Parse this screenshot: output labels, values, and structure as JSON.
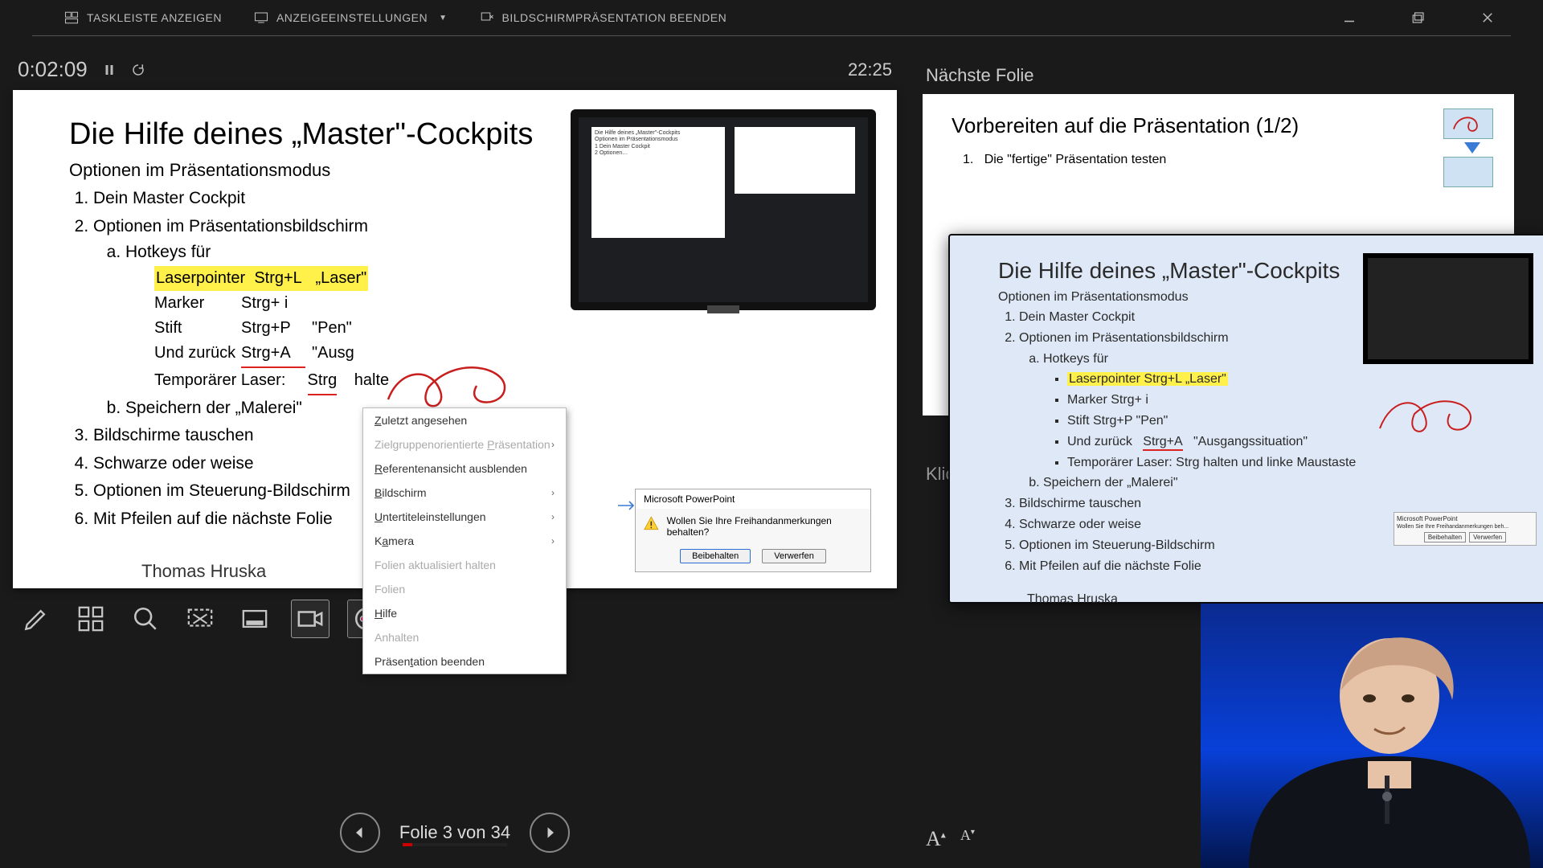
{
  "topbar": {
    "show_taskbar": "TASKLEISTE ANZEIGEN",
    "display_settings": "ANZEIGEEINSTELLUNGEN",
    "end_slideshow": "BILDSCHIRMPRÄSENTATION BEENDEN"
  },
  "timer": {
    "elapsed": "0:02:09",
    "end_time": "22:25"
  },
  "current_slide": {
    "title": "Die Hilfe deines „Master\"-Cockpits",
    "subtitle": "Optionen im Präsentationsmodus",
    "items": {
      "1": "Dein Master Cockpit",
      "2": "Optionen im Präsentationsbildschirm",
      "2a": "Hotkeys für",
      "hk_laser_lbl": "Laserpointer",
      "hk_laser_key": "Strg+L",
      "hk_laser_note": "„Laser\"",
      "hk_marker_lbl": "Marker",
      "hk_marker_key": "Strg+ i",
      "hk_pen_lbl": "Stift",
      "hk_pen_key": "Strg+P",
      "hk_pen_note": "\"Pen\"",
      "hk_back_lbl": "Und zurück",
      "hk_back_key": "Strg+A",
      "hk_back_note": "\"Ausg",
      "hk_temp_lbl": "Temporärer Laser:",
      "hk_temp_key": "Strg",
      "hk_temp_note": "halte",
      "2b": "Speichern der „Malerei\"",
      "3": "Bildschirme tauschen",
      "4": "Schwarze oder weise",
      "5": "Optionen im Steuerung-Bildschirm",
      "6": "Mit Pfeilen auf die nächste Folie"
    },
    "author": "Thomas Hruska"
  },
  "pp_dialog": {
    "title": "Microsoft PowerPoint",
    "msg": "Wollen Sie Ihre Freihandanmerkungen behalten?",
    "keep": "Beibehalten",
    "discard": "Verwerfen"
  },
  "ctx_menu": {
    "last_viewed": "Zuletzt angesehen",
    "zielgruppen": "Zielgruppenorientierte Präsentation",
    "hide_presenter": "Referentenansicht ausblenden",
    "bildschirm": "Bildschirm",
    "subtitles": "Untertiteleinstellungen",
    "kamera": "Kamera",
    "updated": "Folien aktualisiert halten",
    "folien": "Folien",
    "hilfe": "Hilfe",
    "anhalten": "Anhalten",
    "end": "Präsentation beenden"
  },
  "slide_nav": {
    "label": "Folie 3 von 34"
  },
  "right": {
    "next_label": "Nächste Folie",
    "next_title": "Vorbereiten auf die Präsentation (1/2)",
    "next_item1_num": "1.",
    "next_item1": "Die \"fertige\" Präsentation testen",
    "click_hint": "Klic"
  },
  "photo_monitor": {
    "title": "Die Hilfe deines „Master\"-Cockpits",
    "sub": "Optionen im Präsentationsmodus",
    "i1": "Dein Master Cockpit",
    "i2": "Optionen im Präsentationsbildschirm",
    "i2a": "Hotkeys für",
    "hk1": "Laserpointer  Strg+L   „Laser\"",
    "hk2": "Marker          Strg+ i",
    "hk3": "Stift              Strg+P   \"Pen\"",
    "hk4": "Und zurück    Strg+A   \"Ausgangssituation\"",
    "hk5": "Temporärer Laser:  Strg halten und linke Maustaste",
    "i2b": "Speichern der „Malerei\"",
    "i3": "Bildschirme tauschen",
    "i4": "Schwarze oder weise",
    "i5": "Optionen im Steuerung-Bildschirm",
    "i6": "Mit Pfeilen auf die nächste Folie",
    "author": "Thomas Hruska",
    "dlg_keep": "Beibehalten",
    "dlg_discard": "Verwerfen"
  }
}
